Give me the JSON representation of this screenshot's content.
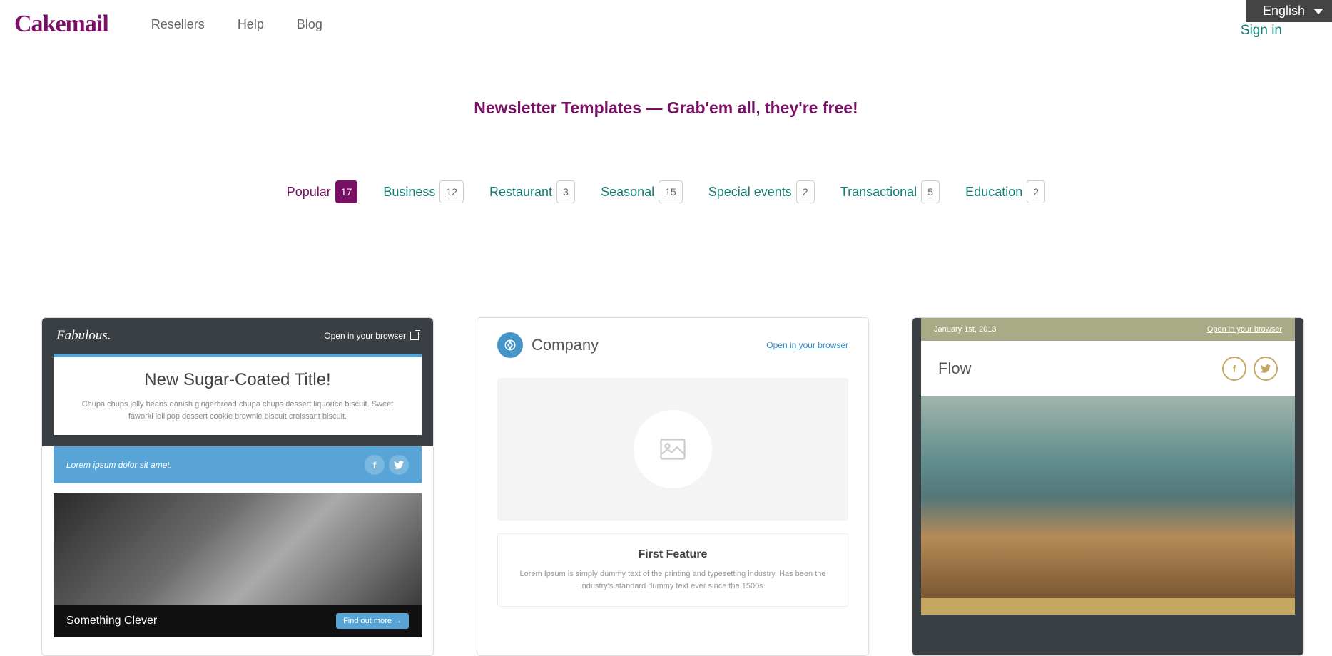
{
  "header": {
    "logo": "Cakemail",
    "nav": {
      "resellers": "Resellers",
      "help": "Help",
      "blog": "Blog"
    },
    "signin": "Sign in",
    "language": "English"
  },
  "page_title": "Newsletter Templates — Grab'em all, they're free!",
  "filters": [
    {
      "label": "Popular",
      "count": "17",
      "active": true
    },
    {
      "label": "Business",
      "count": "12",
      "active": false
    },
    {
      "label": "Restaurant",
      "count": "3",
      "active": false
    },
    {
      "label": "Seasonal",
      "count": "15",
      "active": false
    },
    {
      "label": "Special events",
      "count": "2",
      "active": false
    },
    {
      "label": "Transactional",
      "count": "5",
      "active": false
    },
    {
      "label": "Education",
      "count": "2",
      "active": false
    }
  ],
  "cards": {
    "fabulous": {
      "brand": "Fabulous.",
      "open_in_browser": "Open in your browser",
      "headline": "New Sugar-Coated Title!",
      "blurb": "Chupa chups jelly beans danish gingerbread chupa chups dessert liquorice biscuit. Sweet faworki lollipop dessert cookie brownie biscuit croissant biscuit.",
      "subline": "Lorem ipsum dolor sit amet.",
      "bottom_title": "Something Clever",
      "cta": "Find out more →"
    },
    "company": {
      "brand": "Company",
      "open_in_browser": "Open in your browser",
      "feature_title": "First Feature",
      "feature_body": "Lorem Ipsum is simply dummy text of the printing and typesetting industry. Has been the industry's standard dummy text ever since the 1500s."
    },
    "flow": {
      "date": "January 1st, 2013",
      "open_in_browser": "Open in your browser",
      "brand": "Flow"
    }
  }
}
